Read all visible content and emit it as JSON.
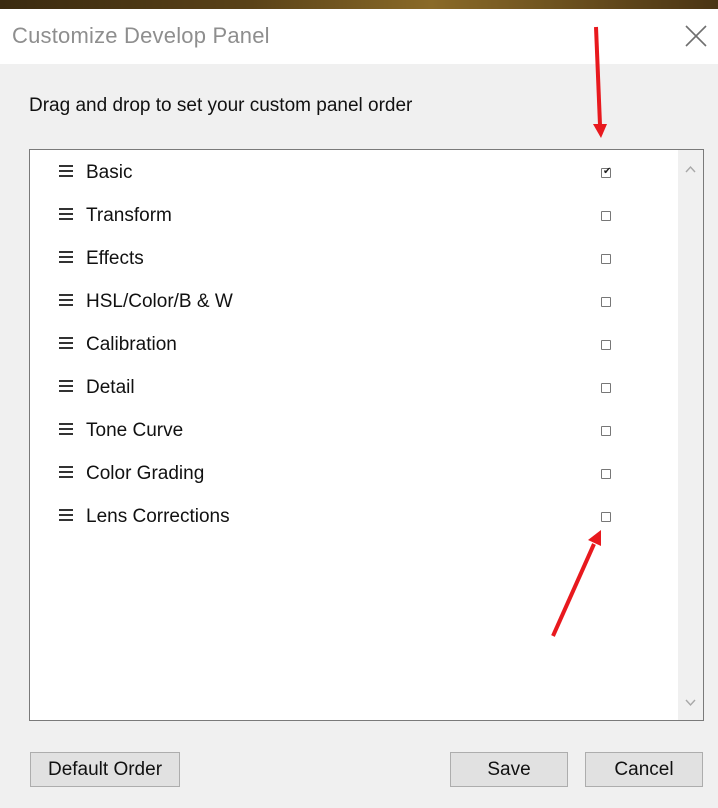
{
  "dialog": {
    "title": "Customize Develop Panel",
    "instruction": "Drag and drop to set your custom panel order"
  },
  "icons": {
    "close": "close-icon",
    "drag": "drag-handle-icon",
    "checkbox": "checkbox-icon",
    "scroll_up": "chevron-up-icon",
    "scroll_down": "chevron-down-icon",
    "annotation": "red-arrow-annotation"
  },
  "panels": [
    {
      "label": "Basic",
      "checked": true
    },
    {
      "label": "Transform",
      "checked": false
    },
    {
      "label": "Effects",
      "checked": false
    },
    {
      "label": "HSL/Color/B & W",
      "checked": false
    },
    {
      "label": "Calibration",
      "checked": false
    },
    {
      "label": "Detail",
      "checked": false
    },
    {
      "label": "Tone Curve",
      "checked": false
    },
    {
      "label": "Color Grading",
      "checked": false
    },
    {
      "label": "Lens Corrections",
      "checked": false
    }
  ],
  "buttons": {
    "default_order": "Default Order",
    "save": "Save",
    "cancel": "Cancel"
  },
  "colors": {
    "annotation_arrow": "#e8191e",
    "title_text": "#8e8e8e",
    "dialog_bg": "#f0f0f0"
  }
}
